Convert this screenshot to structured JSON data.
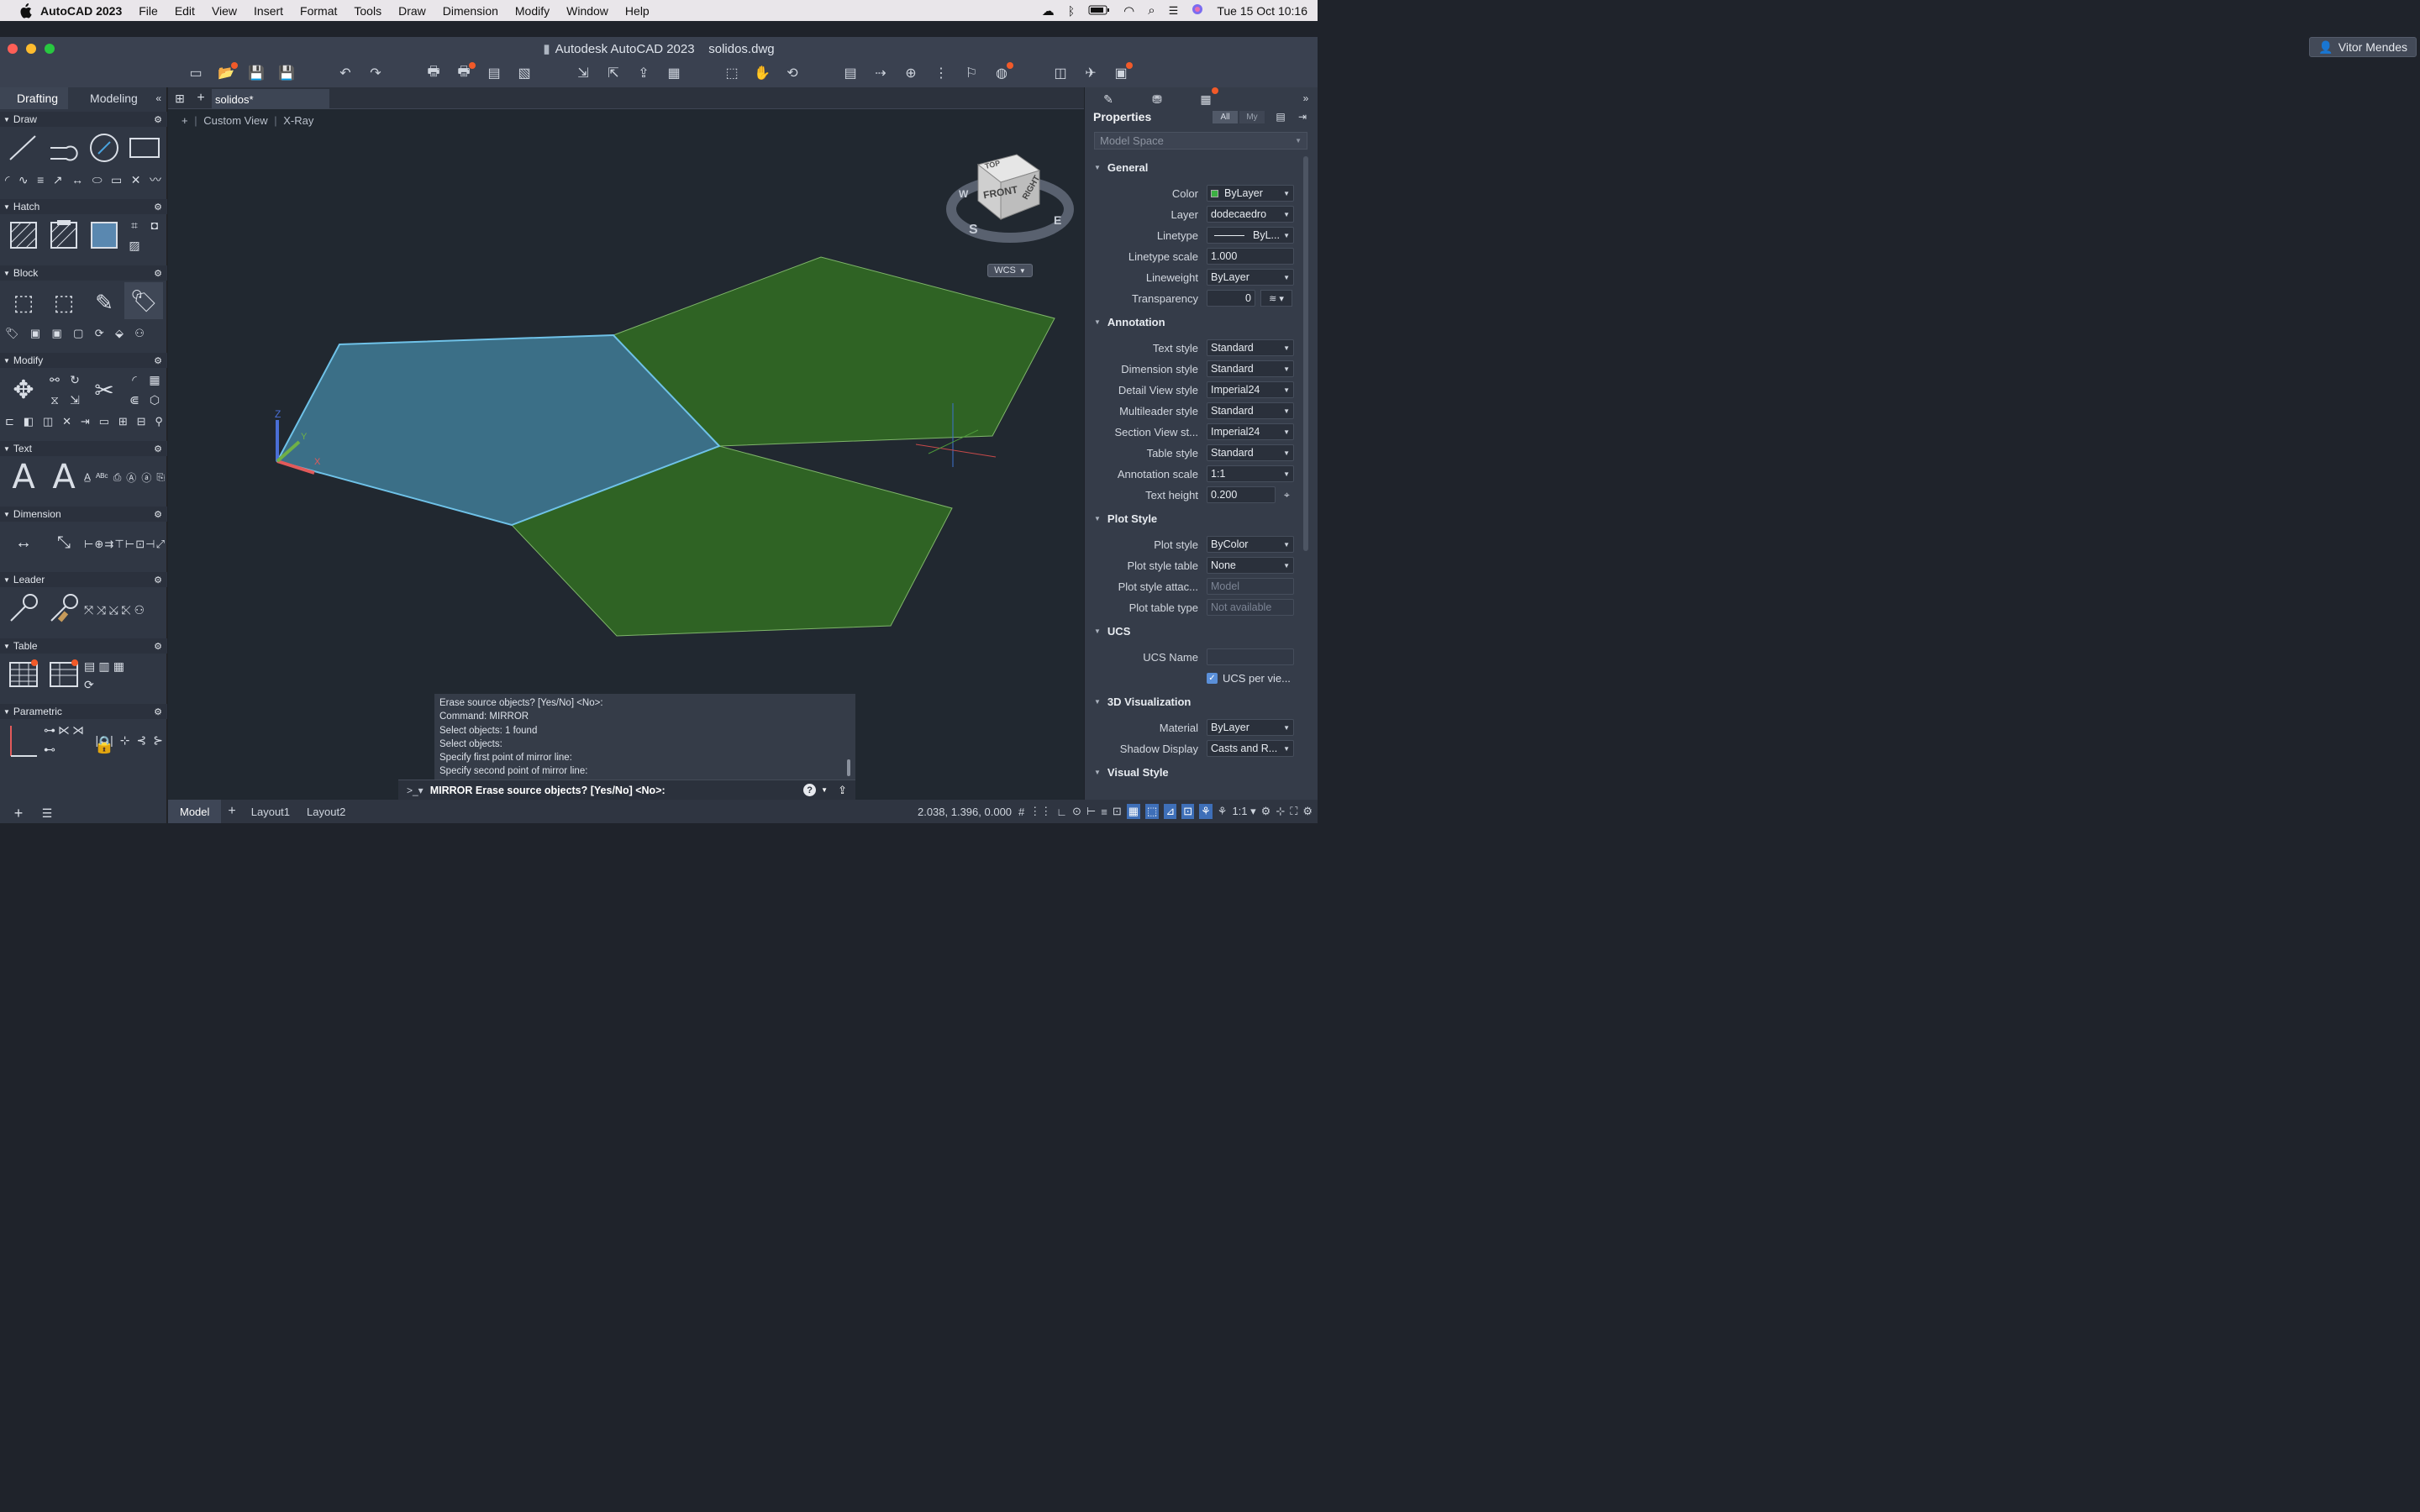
{
  "menubar": {
    "app": "AutoCAD 2023",
    "items": [
      "File",
      "Edit",
      "View",
      "Insert",
      "Format",
      "Tools",
      "Draw",
      "Dimension",
      "Modify",
      "Window",
      "Help"
    ],
    "datetime": "Tue 15 Oct  10:16"
  },
  "window": {
    "title": "Autodesk AutoCAD 2023    solidos.dwg",
    "user": "Vitor Mendes"
  },
  "palette": {
    "tabs": [
      "Drafting",
      "Modeling"
    ],
    "sections": [
      "Draw",
      "Hatch",
      "Block",
      "Modify",
      "Text",
      "Dimension",
      "Leader",
      "Table",
      "Parametric"
    ]
  },
  "doc": {
    "tab": "solidos*",
    "view_label": "Custom View",
    "visual_style": "X-Ray"
  },
  "viewcube": {
    "top": "TOP",
    "front": "FRONT",
    "right": "RIGHT",
    "w": "W",
    "s": "S",
    "e": "E",
    "wcs": "WCS",
    "ucs_z": "Z",
    "ucs_y": "Y",
    "ucs_x": "X"
  },
  "properties": {
    "title": "Properties",
    "filter_all": "All",
    "filter_my": "My",
    "selection": "Model Space",
    "general": {
      "header": "General",
      "rows": [
        {
          "label": "Color",
          "value": "ByLayer"
        },
        {
          "label": "Layer",
          "value": "dodecaedro"
        },
        {
          "label": "Linetype",
          "value": "ByL..."
        },
        {
          "label": "Linetype scale",
          "value": "1.000"
        },
        {
          "label": "Lineweight",
          "value": "ByLayer"
        },
        {
          "label": "Transparency",
          "value": "0"
        }
      ]
    },
    "annotation": {
      "header": "Annotation",
      "rows": [
        {
          "label": "Text style",
          "value": "Standard"
        },
        {
          "label": "Dimension style",
          "value": "Standard"
        },
        {
          "label": "Detail View style",
          "value": "Imperial24"
        },
        {
          "label": "Multileader style",
          "value": "Standard"
        },
        {
          "label": "Section View st...",
          "value": "Imperial24"
        },
        {
          "label": "Table style",
          "value": "Standard"
        },
        {
          "label": "Annotation scale",
          "value": "1:1"
        },
        {
          "label": "Text height",
          "value": "0.200"
        }
      ]
    },
    "plot": {
      "header": "Plot Style",
      "rows": [
        {
          "label": "Plot style",
          "value": "ByColor"
        },
        {
          "label": "Plot style table",
          "value": "None"
        },
        {
          "label": "Plot style attac...",
          "value": "Model"
        },
        {
          "label": "Plot table type",
          "value": "Not available"
        }
      ]
    },
    "ucs": {
      "header": "UCS",
      "name_label": "UCS Name",
      "per_view": "UCS per vie..."
    },
    "vis3d": {
      "header": "3D Visualization",
      "rows": [
        {
          "label": "Material",
          "value": "ByLayer"
        },
        {
          "label": "Shadow Display",
          "value": "Casts and R..."
        }
      ]
    },
    "visual_style": {
      "header": "Visual Style"
    }
  },
  "command": {
    "history": [
      "Erase source objects? [Yes/No] <No>:",
      "Command: MIRROR",
      "Select objects: 1 found",
      "Select objects:",
      "Specify first point of mirror line:",
      "Specify second point of mirror line:"
    ],
    "prompt": "MIRROR Erase source objects? [Yes/No] <No>:"
  },
  "statusbar": {
    "tabs": [
      "Model",
      "Layout1",
      "Layout2"
    ],
    "coords": "2.038, 1.396, 0.000",
    "scale": "1:1"
  },
  "colors": {
    "selected_face": "#3b6f87",
    "face": "#2f6324",
    "accent": "#f15a29"
  }
}
